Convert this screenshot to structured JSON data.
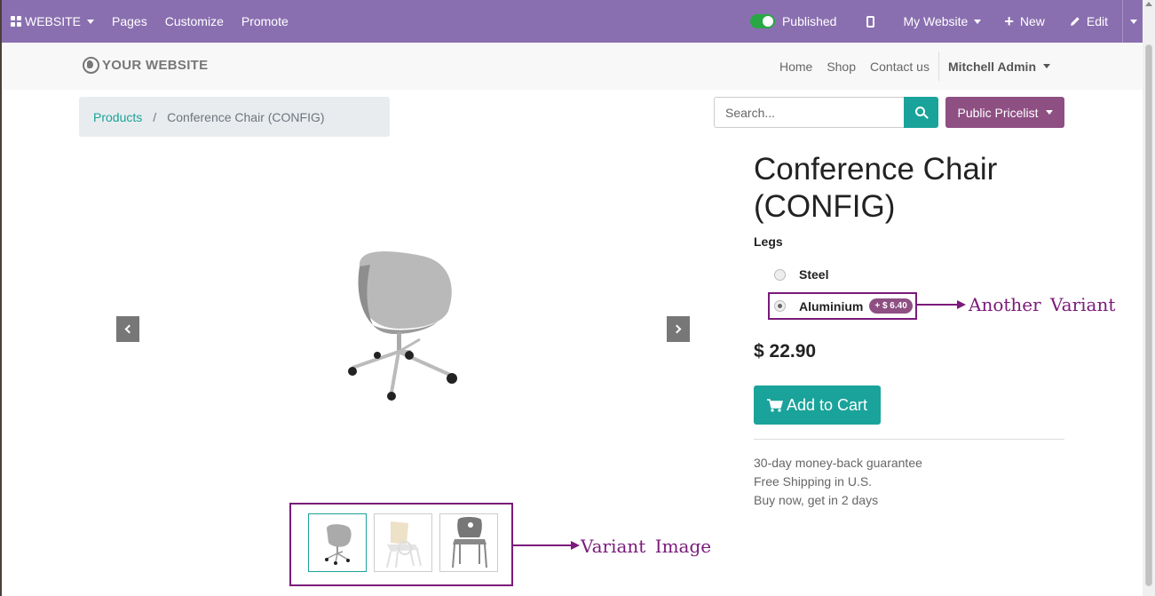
{
  "admin_bar": {
    "website_menu": "WEBSITE",
    "pages": "Pages",
    "customize": "Customize",
    "promote": "Promote",
    "published": "Published",
    "my_website": "My Website",
    "new": "New",
    "edit": "Edit"
  },
  "site": {
    "logo_text": "YOUR WEBSITE",
    "nav": [
      "Home",
      "Shop",
      "Contact us"
    ],
    "user": "Mitchell Admin"
  },
  "breadcrumb": {
    "link": "Products",
    "separator": "/",
    "current": "Conference Chair (CONFIG)"
  },
  "search": {
    "placeholder": "Search..."
  },
  "pricelist": {
    "label": "Public Pricelist"
  },
  "product": {
    "title": "Conference Chair (CONFIG)",
    "attribute_label": "Legs",
    "options": [
      {
        "label": "Steel",
        "selected": false
      },
      {
        "label": "Aluminium",
        "selected": true,
        "extra": "+ $ 6.40"
      }
    ],
    "price": "$ 22.90",
    "add_to_cart": "Add to Cart",
    "info": [
      "30-day money-back guarantee",
      "Free Shipping in U.S.",
      "Buy now, get in 2 days"
    ]
  },
  "annotations": {
    "variant_image": "Variant Image",
    "another_variant": "Another Variant"
  },
  "colors": {
    "admin_bar": "#8a6fb0",
    "primary": "#1aa39a",
    "secondary": "#8e4f83",
    "annotation": "#7a1a7a"
  }
}
